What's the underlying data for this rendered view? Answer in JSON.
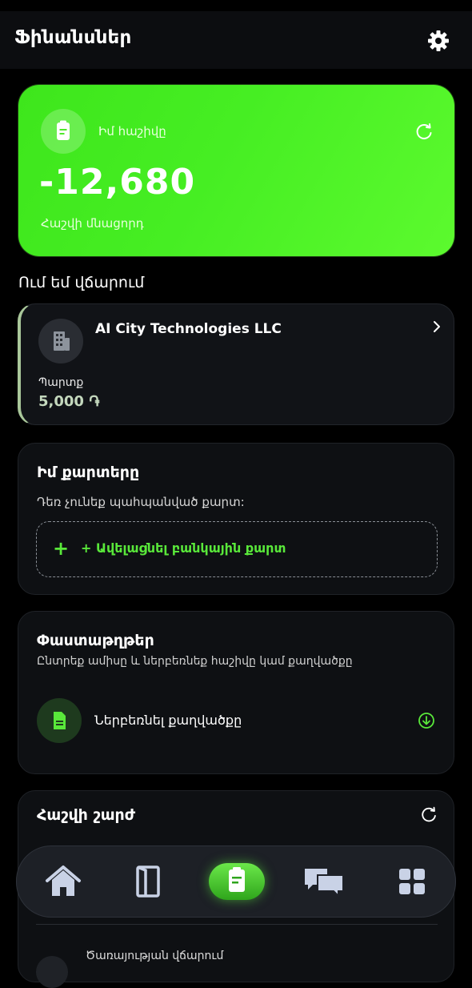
{
  "header": {
    "title": "Ֆինանսներ",
    "settings_icon": "gear-icon"
  },
  "balance_card": {
    "account_label": "Իմ հաշիվը",
    "amount": "-12,680",
    "caption": "Հաշվի մնացորդ",
    "accent_color": "#46ee23"
  },
  "owe_section": {
    "title": "Ում եմ վճարում",
    "company": "AI City Technologies LLC",
    "debt_label": "Պարտք",
    "debt_amount": "5,000 ֏"
  },
  "cards_section": {
    "title": "Իմ քարտերը",
    "empty_text": "Դեռ չունեք պահպանված քարտ:",
    "add_plus": "+",
    "add_label": "+ Ավելացնել բանկային քարտ"
  },
  "documents_section": {
    "title": "Փաստաթղթեր",
    "subtitle": "Ընտրեք ամիսը և ներբեռնեք հաշիվը կամ քաղվածքը",
    "download_label": "Ներբեռնել քաղվածքը"
  },
  "movements_section": {
    "title": "Հաշվի շարժ",
    "row_label": "Ծառայության վճարում"
  },
  "bottom_nav": {
    "items": [
      "home-icon",
      "doors-icon",
      "account-icon",
      "chat-icon",
      "apps-icon"
    ],
    "active": "account-icon"
  }
}
